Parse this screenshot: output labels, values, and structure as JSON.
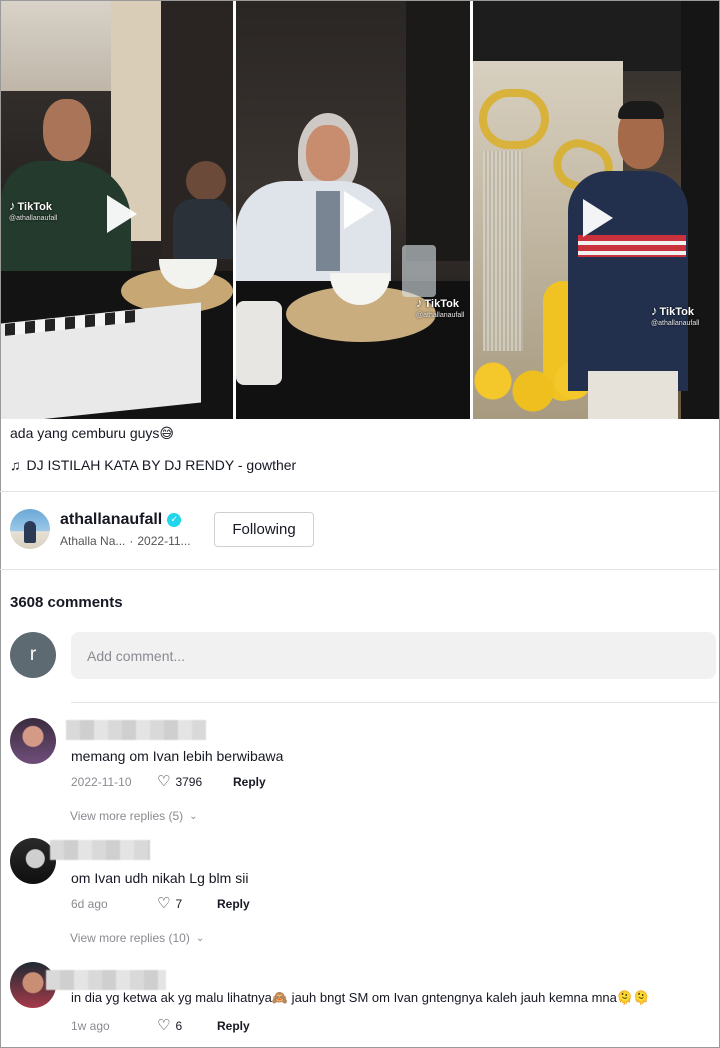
{
  "video_tiles": [
    {
      "brand": "TikTok",
      "handle": "@athallanaufall"
    },
    {
      "brand": "TikTok",
      "handle": "@athallanaufall"
    },
    {
      "brand": "TikTok",
      "handle": "@athallanaufall"
    }
  ],
  "caption": "ada yang cemburu guys😅",
  "music": "DJ ISTILAH KATA BY DJ RENDY - gowther",
  "author": {
    "username": "athallanaufall",
    "display_name": "Athalla Na...",
    "date": "2022-11...",
    "separator": "·",
    "follow_label": "Following"
  },
  "comments_count": "3608 comments",
  "my_avatar_letter": "r",
  "add_comment_placeholder": "Add comment...",
  "comments": [
    {
      "text": "memang om Ivan lebih berwibawa",
      "date": "2022-11-10",
      "likes": "3796",
      "reply": "Reply",
      "more_replies": "View more replies (5)"
    },
    {
      "text": "om Ivan udh nikah Lg blm sii",
      "date": "6d ago",
      "likes": "7",
      "reply": "Reply",
      "more_replies": "View more replies (10)"
    },
    {
      "text": "in dia yg ketwa ak yg malu lihatnya🙈 jauh bngt SM om Ivan gntengnya kaleh jauh kemna mna🫠🫠",
      "date": "1w ago",
      "likes": "6",
      "reply": "Reply"
    }
  ],
  "colors": {
    "accent": "#20d5ec",
    "text": "#161823",
    "muted": "#8a8b91",
    "input_bg": "#f1f1f2"
  }
}
